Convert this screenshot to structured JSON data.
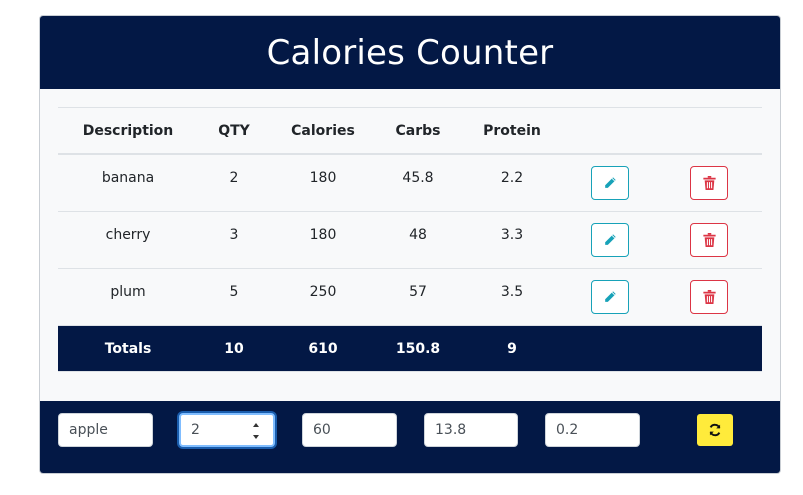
{
  "header": {
    "title": "Calories Counter"
  },
  "table": {
    "columns": [
      "Description",
      "QTY",
      "Calories",
      "Carbs",
      "Protein"
    ],
    "rows": [
      [
        "banana",
        "2",
        "180",
        "45.8",
        "2.2"
      ],
      [
        "cherry",
        "3",
        "180",
        "48",
        "3.3"
      ],
      [
        "plum",
        "5",
        "250",
        "57",
        "3.5"
      ]
    ],
    "totals": [
      "Totals",
      "10",
      "610",
      "150.8",
      "9"
    ]
  },
  "form": {
    "description": "apple",
    "qty": "2",
    "calories": "60",
    "carbs": "13.8",
    "protein": "0.2"
  },
  "icons": {
    "edit": "pencil-icon",
    "delete": "trash-icon",
    "refresh": "refresh-icon"
  },
  "colors": {
    "navy": "#031845",
    "edit": "#17a2b8",
    "delete": "#dc3545",
    "refresh_bg": "#ffeb3b"
  }
}
